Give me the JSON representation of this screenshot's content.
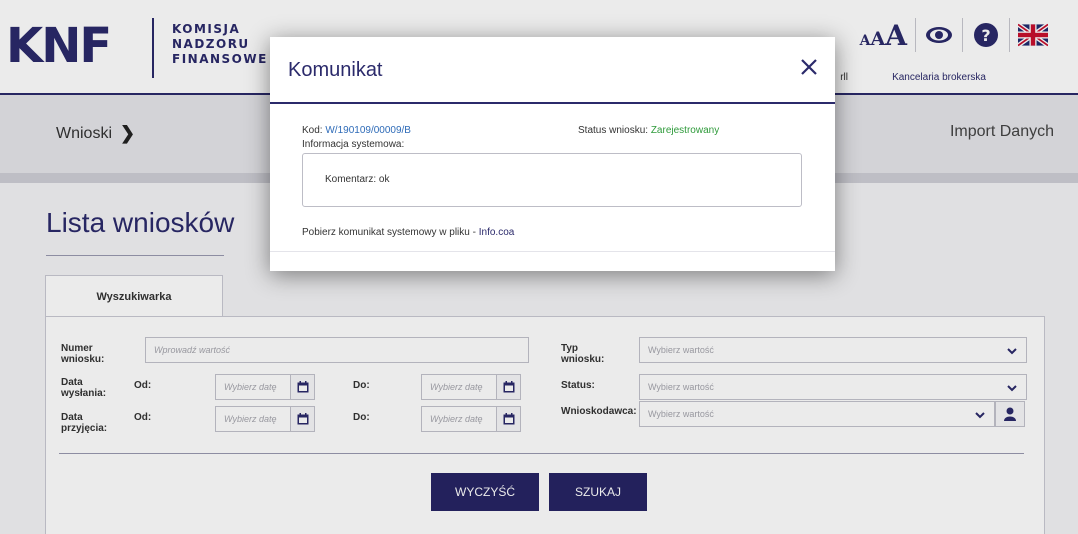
{
  "header": {
    "logo": "KNF",
    "org_lines": [
      "KOMISJA",
      "NADZORU",
      "FINANSOWE"
    ],
    "font_size_labels": [
      "A",
      "A",
      "A"
    ],
    "icons": [
      "eye-icon",
      "help-icon",
      "uk-flag-icon"
    ],
    "user_fragment": "rll",
    "broker_label": "Kancelaria brokerska"
  },
  "toolbar": {
    "breadcrumb": "Wnioski",
    "import_label": "Import Danych"
  },
  "main": {
    "title": "Lista wniosków",
    "tab_label": "Wyszukiwarka",
    "form": {
      "numer_label_1": "Numer",
      "numer_label_2": "wniosku:",
      "numer_placeholder": "Wprowadź wartość",
      "data_wys_1": "Data",
      "data_wys_2": "wysłania:",
      "data_prz_1": "Data",
      "data_prz_2": "przyjęcia:",
      "od": "Od:",
      "do": "Do:",
      "date_placeholder": "Wybierz datę",
      "typ_1": "Typ",
      "typ_2": "wniosku:",
      "status_label": "Status:",
      "wnioskodawca_label": "Wnioskodawca:",
      "select_placeholder": "Wybierz wartość"
    },
    "buttons": {
      "clear": "WYCZYŚĆ",
      "search": "SZUKAJ"
    }
  },
  "modal": {
    "title": "Komunikat",
    "kod_label": "Kod:",
    "kod_value": "W/190109/00009/B",
    "status_label": "Status wniosku:",
    "status_value": "Zarejestrowany",
    "info_label": "Informacja systemowa:",
    "comment": "Komentarz: ok",
    "download_text": "Pobierz komunikat systemowy w pliku - ",
    "download_link": "Info.coa"
  },
  "colors": {
    "brand": "#2b2a6b",
    "button": "#262464",
    "link": "#2e6bb8",
    "status_ok": "#2e9a3a"
  }
}
